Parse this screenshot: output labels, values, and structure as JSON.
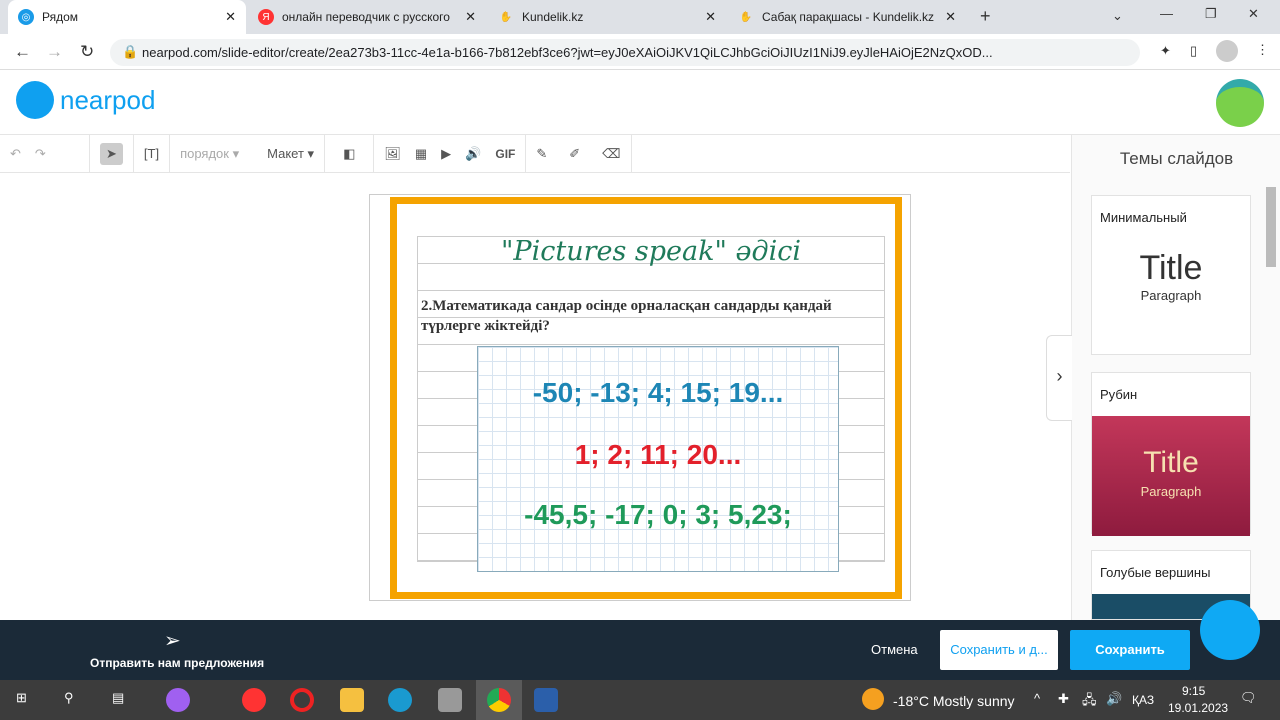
{
  "browser": {
    "tabs": [
      {
        "title": "Рядом",
        "active": true
      },
      {
        "title": "онлайн переводчик с русского"
      },
      {
        "title": "Kundelik.kz"
      },
      {
        "title": "Сабақ парақшасы - Kundelik.kz"
      }
    ],
    "url": "nearpod.com/slide-editor/create/2ea273b3-11cc-4e1a-b166-7b812ebf3ce6?jwt=eyJ0eXAiOiJKV1QiLCJhbGciOiJIUzI1NiJ9.eyJleHAiOjE2NzQxOD..."
  },
  "app": {
    "logo": "nearpod"
  },
  "toolbar": {
    "order": "порядок",
    "layout": "Макет",
    "gif": "GIF"
  },
  "side": {
    "title": "Темы слайдов",
    "themes": [
      {
        "name": "Минимальный",
        "title": "Title",
        "paragraph": "Paragraph"
      },
      {
        "name": "Рубин",
        "title": "Title",
        "paragraph": "Paragraph"
      },
      {
        "name": "Голубые вершины"
      }
    ]
  },
  "slide": {
    "heading": "\"Pictures speak\" әдісі",
    "question": "2.Математикада сандар осінде орналасқан сандарды қандай түрлерге жіктейді?",
    "line1": "-50; -13; 4; 15; 19...",
    "line2": "1; 2; 11; 20...",
    "line3": "-45,5; -17; 0; 3; 5,23;"
  },
  "footer": {
    "feedback": "Отправить нам предложения",
    "cancel": "Отмена",
    "save_and": "Сохранить и д...",
    "save": "Сохранить"
  },
  "taskbar": {
    "weather": "-18°C  Mostly sunny",
    "lang": "ҚАЗ",
    "time": "9:15",
    "date": "19.01.2023"
  }
}
